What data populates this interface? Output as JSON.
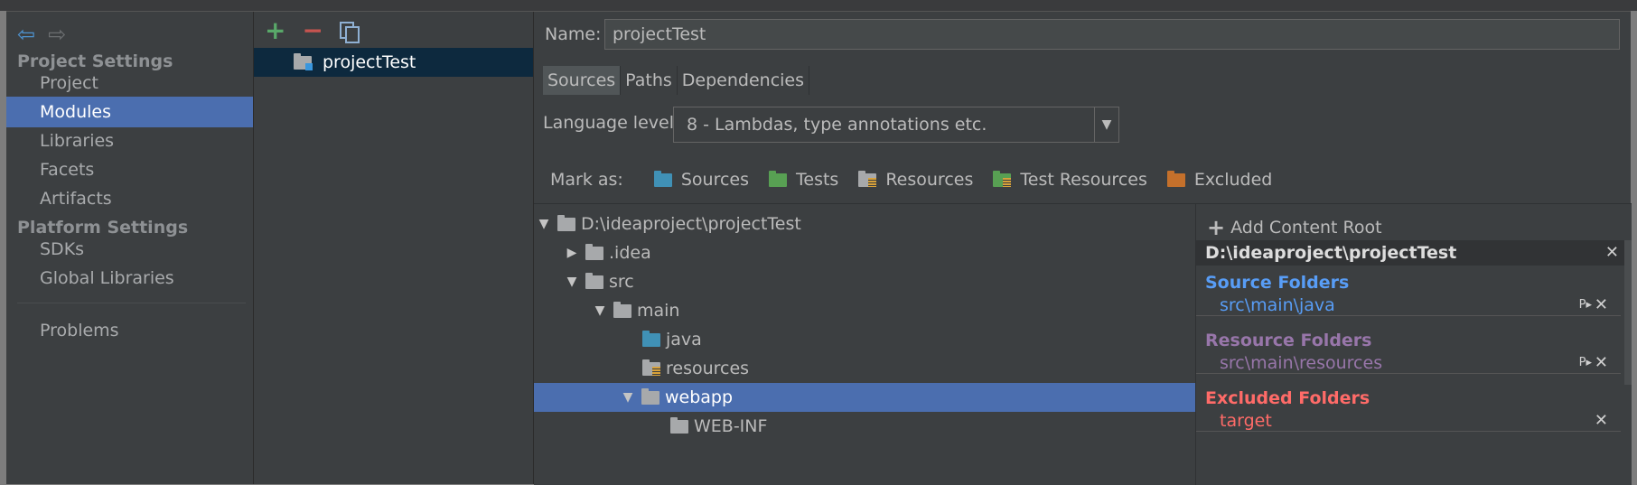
{
  "window": {
    "title": ""
  },
  "left": {
    "project_settings": "Project Settings",
    "items": [
      "Project",
      "Modules",
      "Libraries",
      "Facets",
      "Artifacts"
    ],
    "platform_settings": "Platform Settings",
    "platform_items": [
      "SDKs",
      "Global Libraries"
    ],
    "problems": "Problems"
  },
  "modules": {
    "selected": "projectTest"
  },
  "right": {
    "name_label": "Name:",
    "name_value": "projectTest",
    "tabs": [
      "Sources",
      "Paths",
      "Dependencies"
    ],
    "language_label": "Language level:",
    "language_value": "8 - Lambdas, type annotations etc.",
    "mark_as_label": "Mark as:",
    "mark_options": [
      "Sources",
      "Tests",
      "Resources",
      "Test Resources",
      "Excluded"
    ]
  },
  "tree": {
    "rows": [
      {
        "label": "D:\\ideaproject\\projectTest",
        "expanded": true
      },
      {
        "label": ".idea",
        "expanded": false
      },
      {
        "label": "src",
        "expanded": true
      },
      {
        "label": "main",
        "expanded": true
      },
      {
        "label": "java",
        "kind": "source"
      },
      {
        "label": "resources",
        "kind": "resource"
      },
      {
        "label": "webapp",
        "expanded": true,
        "selected": true
      },
      {
        "label": "WEB-INF"
      }
    ]
  },
  "content": {
    "add_root": "Add Content Root",
    "root_path": "D:\\ideaproject\\projectTest",
    "source_header": "Source Folders",
    "source_entry": "src\\main\\java",
    "resource_header": "Resource Folders",
    "resource_entry": "src\\main\\resources",
    "excluded_header": "Excluded Folders",
    "excluded_entry": "target",
    "p_tag": "P▸",
    "colors": {
      "source": "#589df6",
      "resource": "#9876aa",
      "excluded": "#ff6b68"
    }
  },
  "icons": {
    "back": "back-arrow-icon",
    "forward": "forward-arrow-icon",
    "close": "close-icon"
  }
}
